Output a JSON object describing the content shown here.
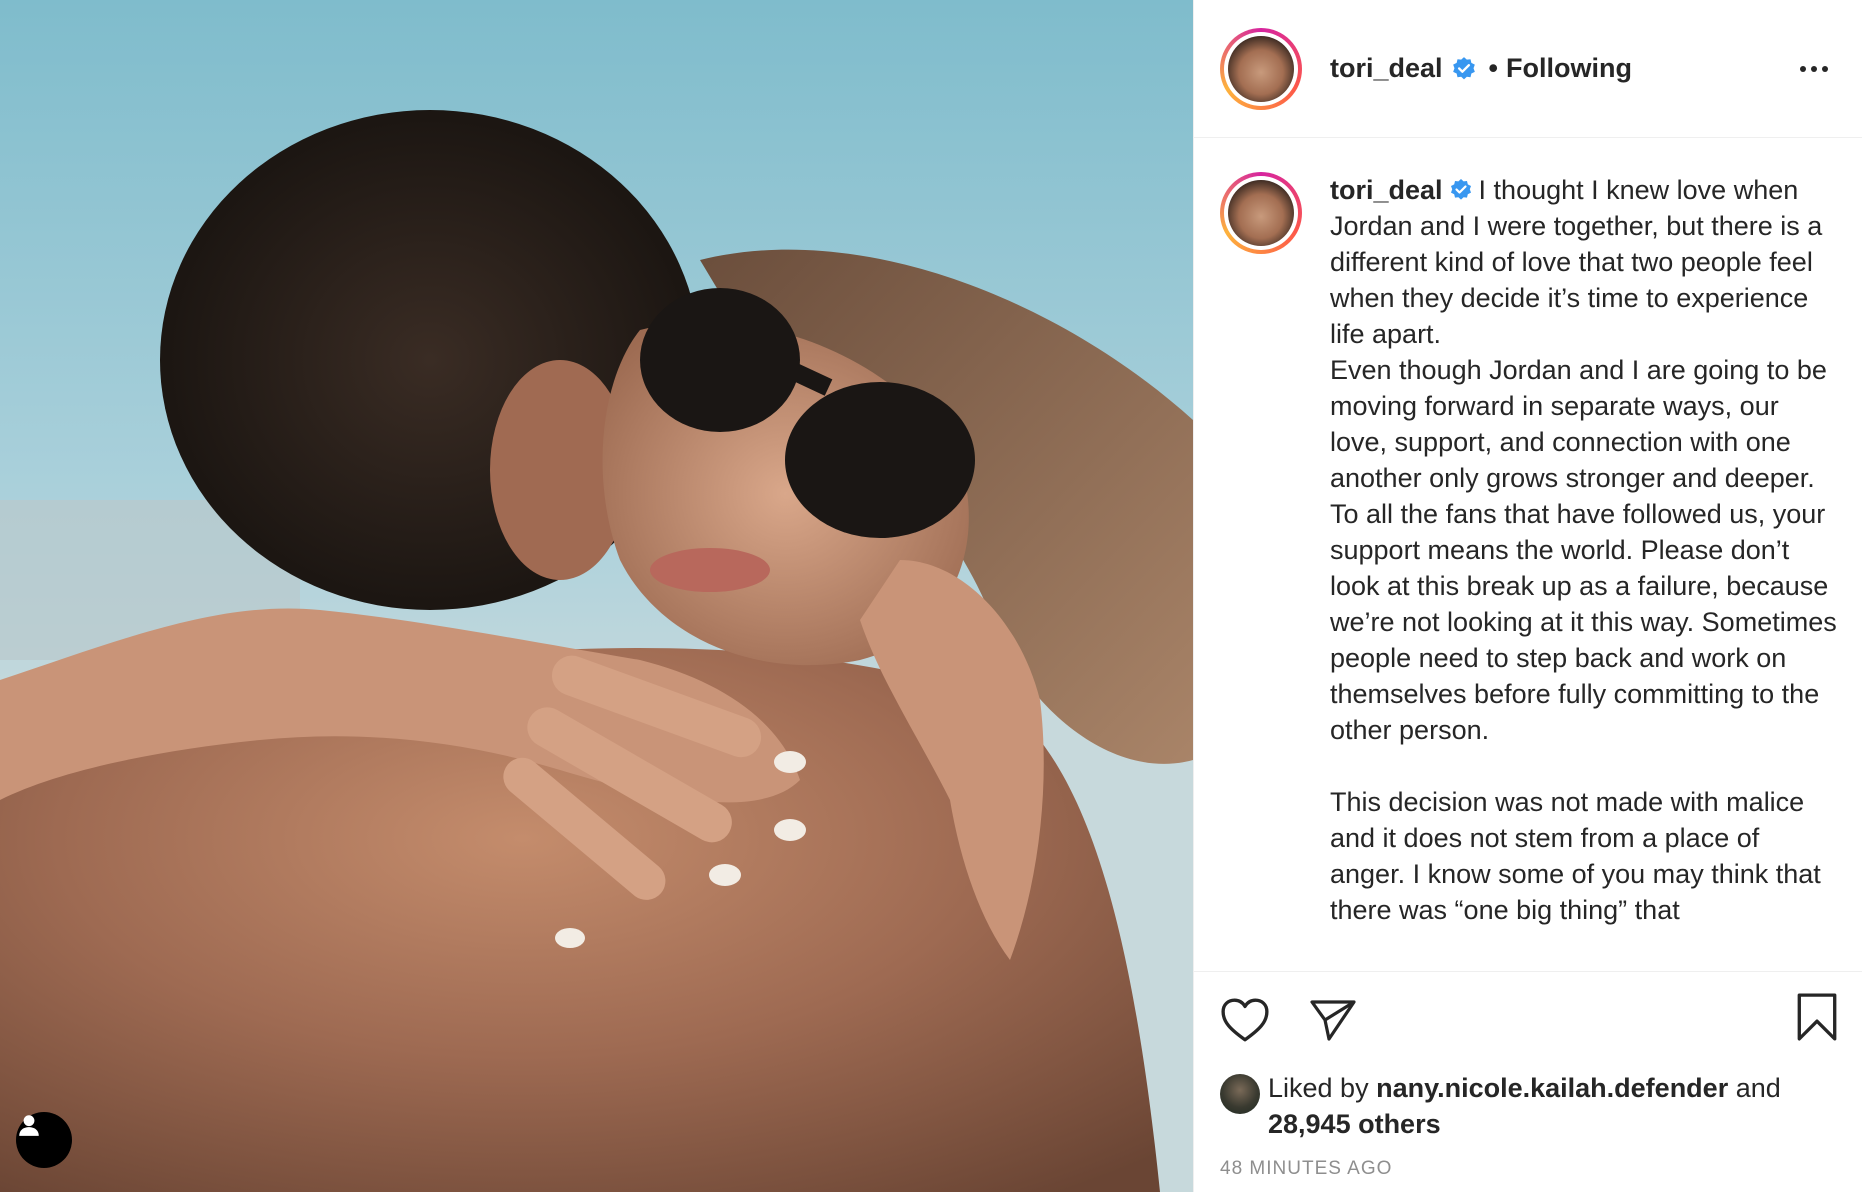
{
  "post": {
    "author": {
      "username": "tori_deal",
      "verified": true,
      "follow_status": "Following"
    },
    "caption": {
      "username": "tori_deal",
      "text": "I thought I knew love when Jordan and I were together, but there is a different kind of love that two people feel when they decide it’s time to experience life apart.\nEven though Jordan and I are going to be moving forward in separate ways, our love, support, and connection with one another only grows stronger and deeper.\nTo all the fans that have followed us, your support means the world. Please don’t look at this break up as a failure, because we’re not looking at it this way. Sometimes people need to step back and work on themselves before fully committing to the other person.\n\nThis decision was not made with malice and it does not stem from a place of anger. I know some of you may think that there was “one big thing” that"
    },
    "likes": {
      "prefix": "Liked by",
      "liker": "nany.nicole.kailah.defender",
      "conjunction": "and",
      "others": "28,945 others"
    },
    "timestamp": "48 MINUTES AGO",
    "photo_alt": "Couple embracing outdoors"
  },
  "icons": {
    "like": "heart-icon",
    "share": "paper-plane-icon",
    "save": "bookmark-icon",
    "more": "ellipsis-icon",
    "verified": "verified-badge-icon",
    "user_tag": "user-icon"
  },
  "colors": {
    "verified_blue": "#3897f0",
    "text": "#262626",
    "muted": "#8e8e8e",
    "border": "#efefef"
  }
}
